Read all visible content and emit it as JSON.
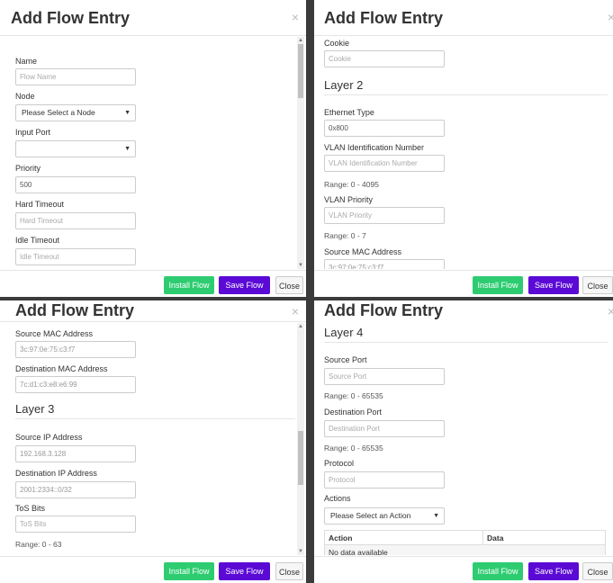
{
  "modal_title": "Add Flow Entry",
  "close_glyph": "×",
  "footer": {
    "install_label": "Install Flow",
    "save_label": "Save Flow",
    "close_label": "Close"
  },
  "panel1": {
    "name_label": "Name",
    "name_placeholder": "Flow Name",
    "node_label": "Node",
    "node_value": "Please Select a Node",
    "port_label": "Input Port",
    "port_value": "",
    "priority_label": "Priority",
    "priority_value": "500",
    "hard_label": "Hard Timeout",
    "hard_placeholder": "Hard Timeout",
    "idle_label": "Idle Timeout",
    "idle_placeholder": "Idle Timeout"
  },
  "panel2": {
    "cookie_label": "Cookie",
    "cookie_placeholder": "Cookie",
    "section": "Layer 2",
    "eth_label": "Ethernet Type",
    "eth_value": "0x800",
    "vlan_label": "VLAN Identification Number",
    "vlan_placeholder": "VLAN Identification Number",
    "vlan_range": "Range: 0 - 4095",
    "vlanp_label": "VLAN Priority",
    "vlanp_placeholder": "VLAN Priority",
    "vlanp_range": "Range: 0 - 7",
    "smac_label": "Source MAC Address",
    "smac_value": "3c:97:0e:75:c3:f7"
  },
  "panel3": {
    "smac_label": "Source MAC Address",
    "smac_value": "3c:97:0e:75:c3:f7",
    "dmac_label": "Destination MAC Address",
    "dmac_value": "7c:d1:c3:e8:e6:99",
    "section": "Layer 3",
    "sip_label": "Source IP Address",
    "sip_value": "192.168.3.128",
    "dip_label": "Destination IP Address",
    "dip_value": "2001:2334::0/32",
    "tos_label": "ToS Bits",
    "tos_placeholder": "ToS Bits",
    "tos_range": "Range: 0 - 63"
  },
  "panel4": {
    "section": "Layer 4",
    "sport_label": "Source Port",
    "sport_placeholder": "Source Port",
    "sport_range": "Range: 0 - 65535",
    "dport_label": "Destination Port",
    "dport_placeholder": "Destination Port",
    "dport_range": "Range: 0 - 65535",
    "proto_label": "Protocol",
    "proto_placeholder": "Protocol",
    "actions_label": "Actions",
    "actions_value": "Please Select an Action",
    "table": {
      "col_action": "Action",
      "col_data": "Data",
      "empty": "No data available"
    }
  }
}
